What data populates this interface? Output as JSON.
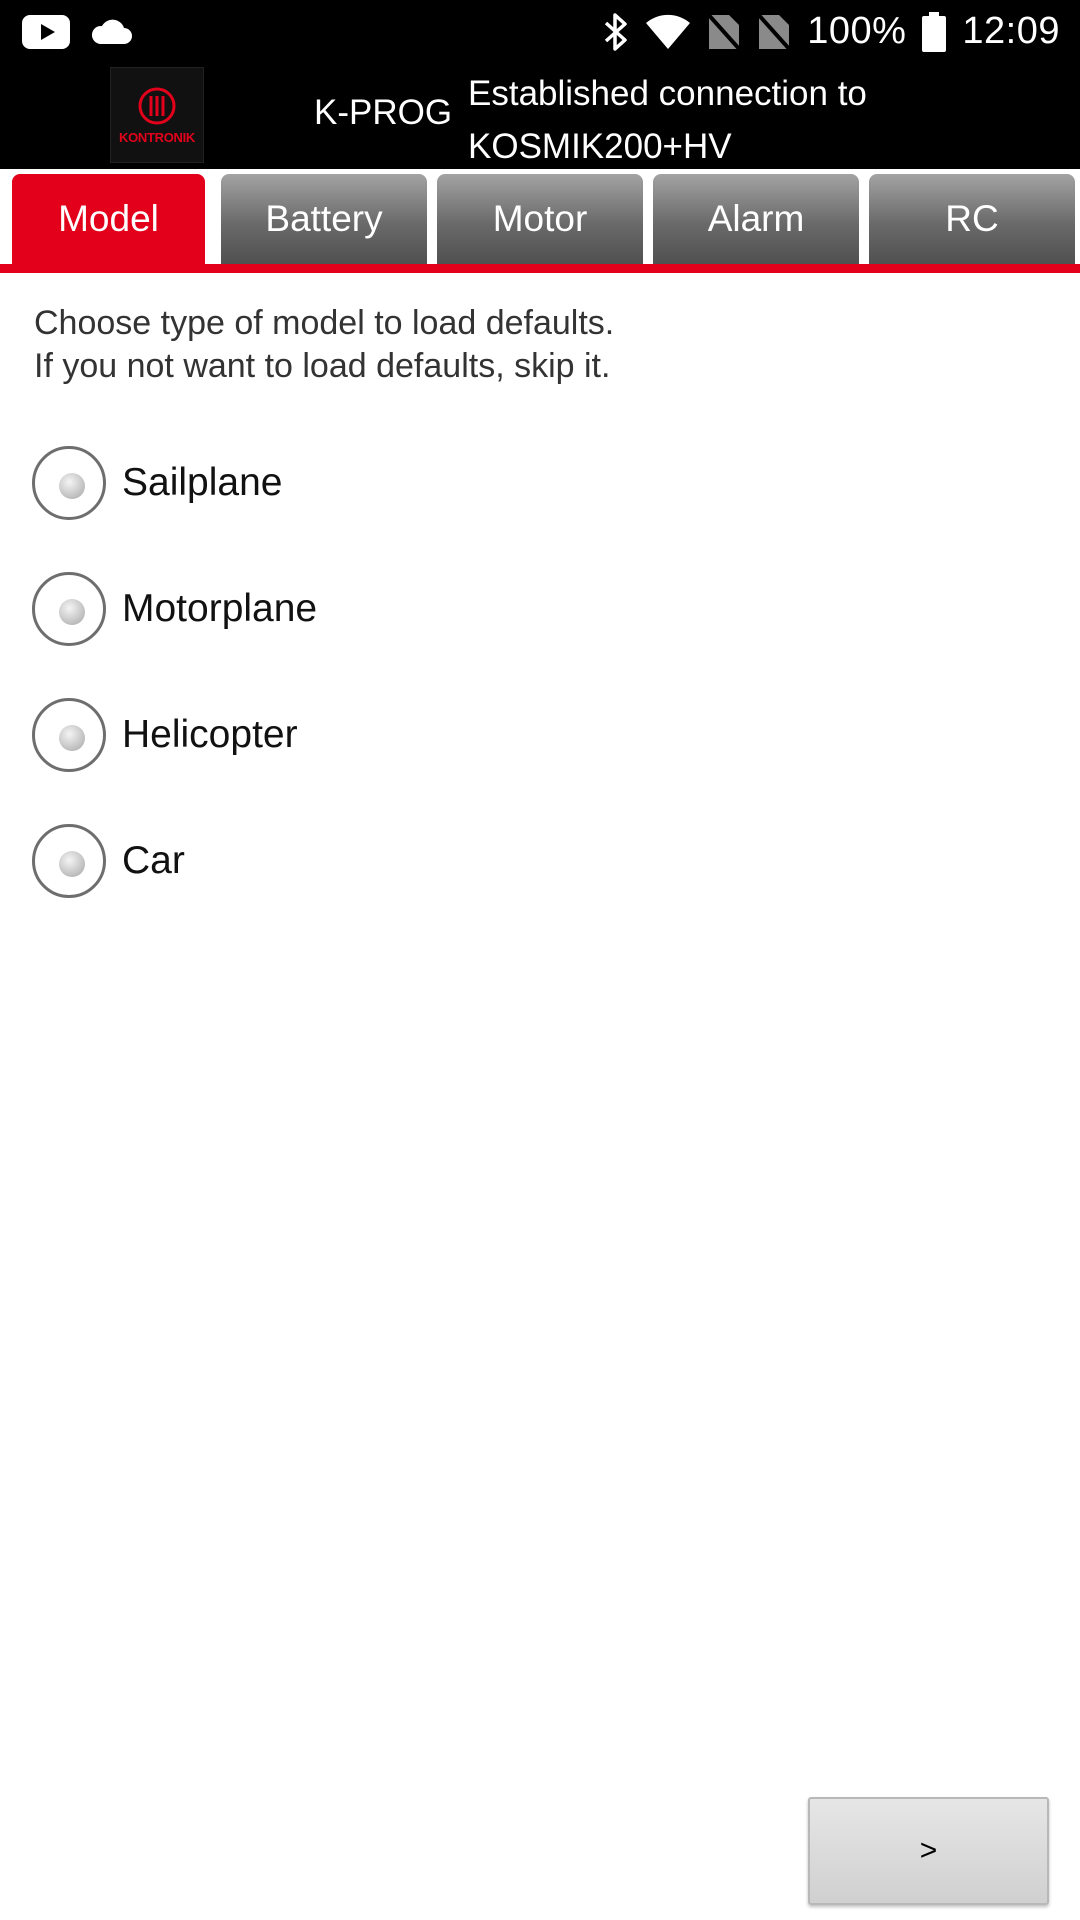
{
  "status_bar": {
    "battery": "100%",
    "time": "12:09",
    "icons": [
      "youtube-icon",
      "cloud-icon",
      "bluetooth-icon",
      "wifi-icon",
      "no-sim-icon",
      "no-sim-icon",
      "battery-icon"
    ]
  },
  "header": {
    "logo_text": "KONTRONIK",
    "app_title": "K-PROG",
    "connection_line1": "Established connection to",
    "connection_line2": "KOSMIK200+HV"
  },
  "tabs": [
    {
      "label": "Model",
      "active": true
    },
    {
      "label": "Battery",
      "active": false
    },
    {
      "label": "Motor",
      "active": false
    },
    {
      "label": "Alarm",
      "active": false
    },
    {
      "label": "RC",
      "active": false
    }
  ],
  "content": {
    "instruction_line1": "Choose type of model to load defaults.",
    "instruction_line2": "If you not want to load defaults, skip it.",
    "options": [
      {
        "label": "Sailplane",
        "selected": false
      },
      {
        "label": "Motorplane",
        "selected": false
      },
      {
        "label": "Helicopter",
        "selected": false
      },
      {
        "label": "Car",
        "selected": false
      }
    ],
    "next_label": ">"
  },
  "colors": {
    "accent": "#e3001b",
    "header_bg": "#000000",
    "tab_inactive": "#6a6a6a"
  }
}
